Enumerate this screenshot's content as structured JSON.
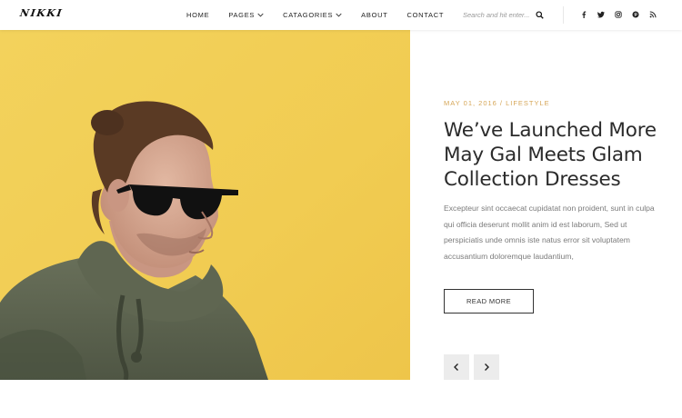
{
  "brand": {
    "logo_text": "NIKKI"
  },
  "nav": {
    "items": [
      {
        "label": "HOME",
        "has_dropdown": false
      },
      {
        "label": "PAGES",
        "has_dropdown": true
      },
      {
        "label": "CATAGORIES",
        "has_dropdown": true
      },
      {
        "label": "ABOUT",
        "has_dropdown": false
      },
      {
        "label": "CONTACT",
        "has_dropdown": false
      }
    ]
  },
  "search": {
    "placeholder": "Search and hit enter...",
    "value": "",
    "icon": "search-icon"
  },
  "social": [
    "facebook-icon",
    "twitter-icon",
    "instagram-icon",
    "pinterest-icon",
    "rss-icon"
  ],
  "hero": {
    "image_icon": "hero-image",
    "meta": "MAY 01, 2016 / LIFESTYLE",
    "title": "We’ve Launched More May Gal Meets Glam Collection Dresses",
    "excerpt": "Excepteur sint occaecat cupidatat non proident, sunt in culpa qui officia deserunt mollit anim id est laborum, Sed ut perspiciatis unde omnis iste natus error sit voluptatem accusantium doloremque laudantium,",
    "read_more_label": "READ MORE"
  },
  "slider": {
    "prev_icon": "chevron-left-icon",
    "next_icon": "chevron-right-icon"
  },
  "colors": {
    "accent": "#d6a657",
    "hero_bg": "#f2cf57",
    "text_dark": "#2b2b2b",
    "text_muted": "#7b7b7b"
  }
}
